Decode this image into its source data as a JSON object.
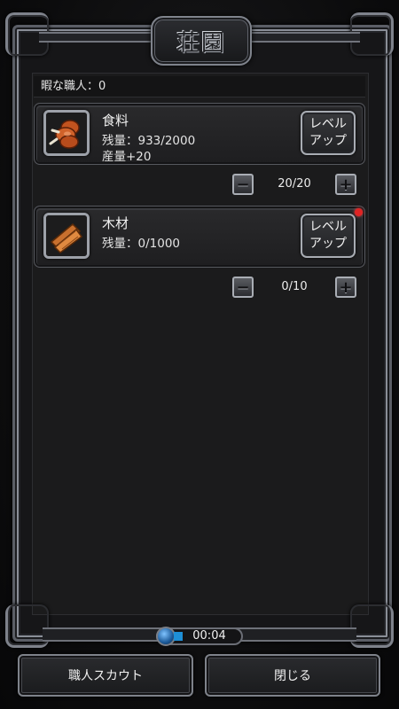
{
  "title": "荘園",
  "idle_workers": "暇な職人：0",
  "resources": [
    {
      "name": "食料",
      "stock": "残量：933/2000",
      "production": "産量+20",
      "levelup_line1": "レベル",
      "levelup_line2": "アップ",
      "allocation": "20/20",
      "icon": "meat-icon",
      "has_notification": false
    },
    {
      "name": "木材",
      "stock": "残量：0/1000",
      "production": "",
      "levelup_line1": "レベル",
      "levelup_line2": "アップ",
      "allocation": "0/10",
      "icon": "wood-planks-icon",
      "has_notification": true
    }
  ],
  "stepper": {
    "minus": "−",
    "plus": "+"
  },
  "timer": "00:04",
  "buttons": {
    "scout": "職人スカウト",
    "close": "閉じる"
  },
  "colors": {
    "notification": "#e02424",
    "timer_gem": "#1e8fd6"
  }
}
